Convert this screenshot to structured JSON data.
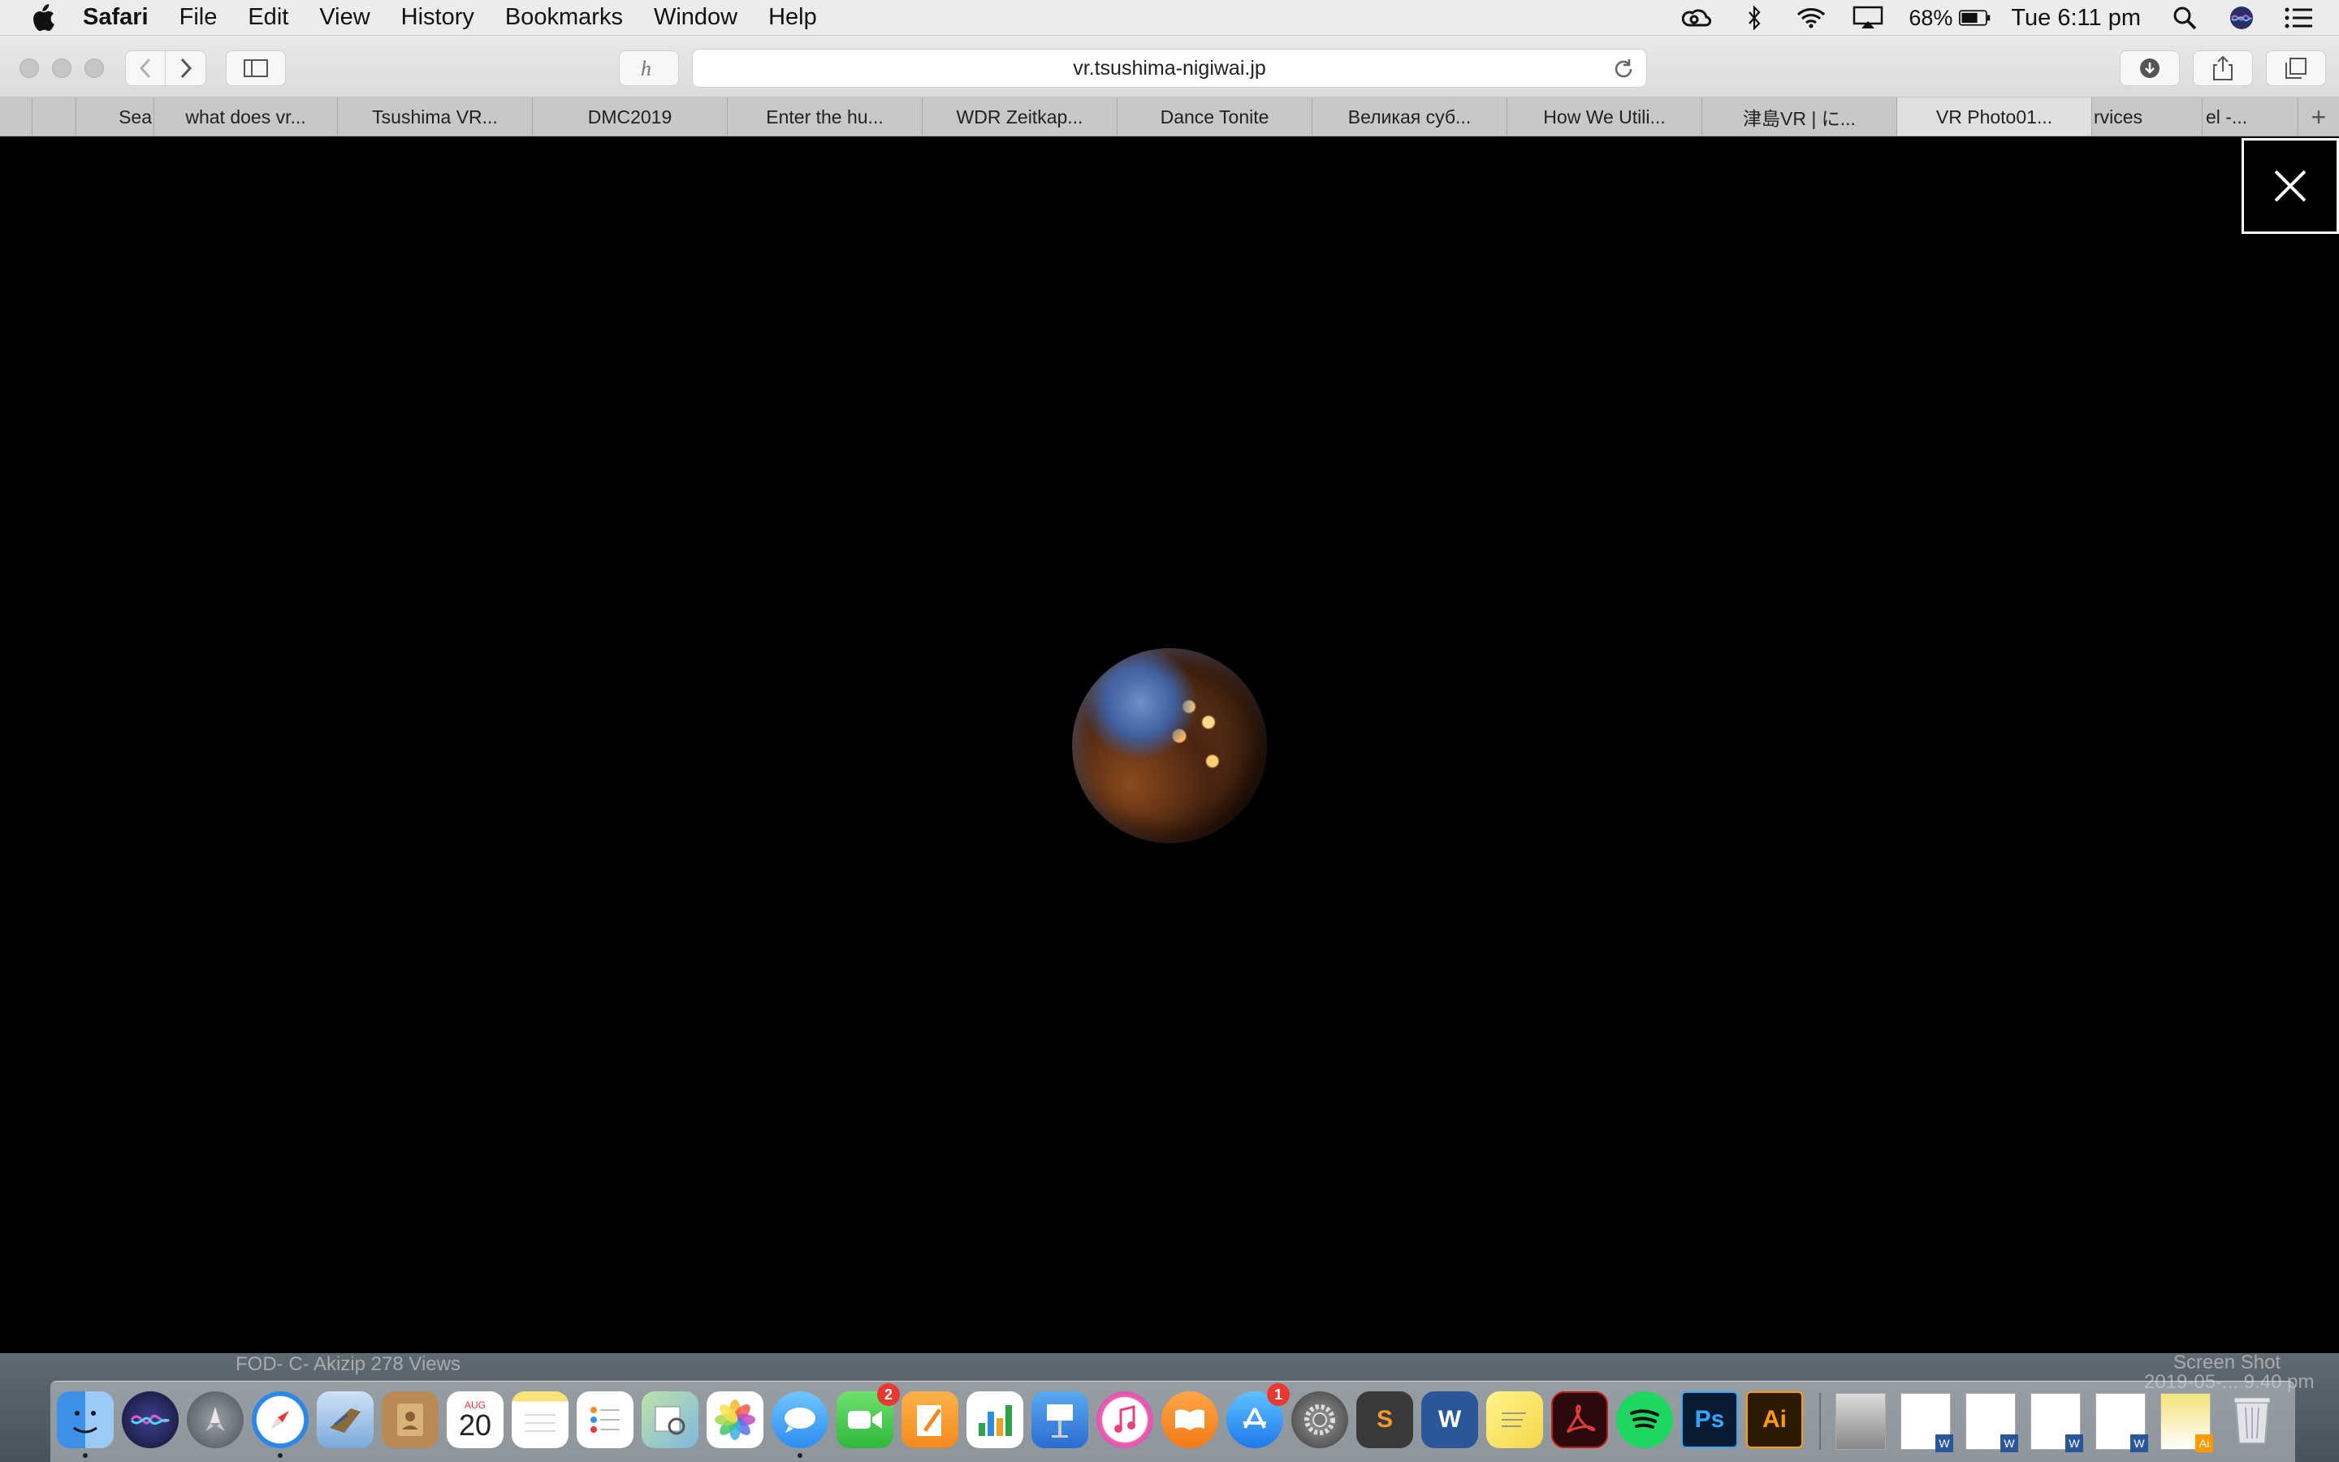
{
  "menubar": {
    "app_name": "Safari",
    "items": [
      "File",
      "Edit",
      "View",
      "History",
      "Bookmarks",
      "Window",
      "Help"
    ],
    "battery": "68%",
    "clock": "Tue 6:11 pm"
  },
  "toolbar": {
    "url": "vr.tsushima-nigiwai.jp"
  },
  "tabs": [
    {
      "label": ""
    },
    {
      "label": "Sea"
    },
    {
      "label": "what does vr..."
    },
    {
      "label": "Tsushima VR..."
    },
    {
      "label": "DMC2019"
    },
    {
      "label": "Enter the hu..."
    },
    {
      "label": "WDR Zeitkap..."
    },
    {
      "label": "Dance Tonite"
    },
    {
      "label": "Великая суб..."
    },
    {
      "label": "How We Utili..."
    },
    {
      "label": "津島VR | に..."
    },
    {
      "label": "VR Photo01..."
    },
    {
      "label": "rvices"
    },
    {
      "label": "el -..."
    }
  ],
  "new_tab_label": "+",
  "desktop": {
    "left_ghost_text": "FOD- C- Akizip 278 Views",
    "right_ghost_text_1": "Screen Shot",
    "right_ghost_text_2": "2019-05-... 9.40 pm"
  },
  "dock": {
    "calendar_month": "AUG",
    "calendar_day": "20",
    "facetime_badge": "2",
    "appstore_badge": "1",
    "photoshop_label": "Ps",
    "illustrator_label": "Ai",
    "word_label": "W",
    "acrobat_label": "A",
    "sublime_label": "S"
  },
  "colors": {
    "menubar_bg": "#ececec",
    "content_bg": "#000000",
    "badge_red": "#e8382f"
  }
}
